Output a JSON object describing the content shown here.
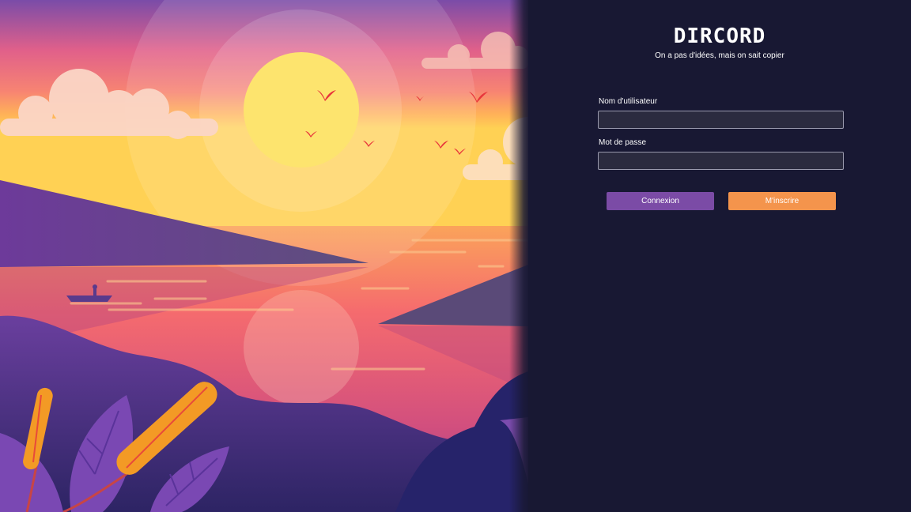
{
  "brand": {
    "logo": "DIRCORD",
    "tagline": "On a pas d'idées, mais on sait copier"
  },
  "form": {
    "username": {
      "label": "Nom d'utilisateur",
      "value": "",
      "placeholder": ""
    },
    "password": {
      "label": "Mot de passe",
      "value": "",
      "placeholder": ""
    }
  },
  "buttons": {
    "login": "Connexion",
    "signup": "M'inscrire"
  },
  "colors": {
    "panel_background": "#181833",
    "input_background": "#2b2b3f",
    "login_button": "#7b4ba6",
    "signup_button": "#f4944c"
  },
  "illustration": {
    "subject": "sunset-lake-landscape",
    "elements": [
      "sun",
      "clouds",
      "birds",
      "hills",
      "lake",
      "boat",
      "cattails",
      "leaves"
    ]
  }
}
